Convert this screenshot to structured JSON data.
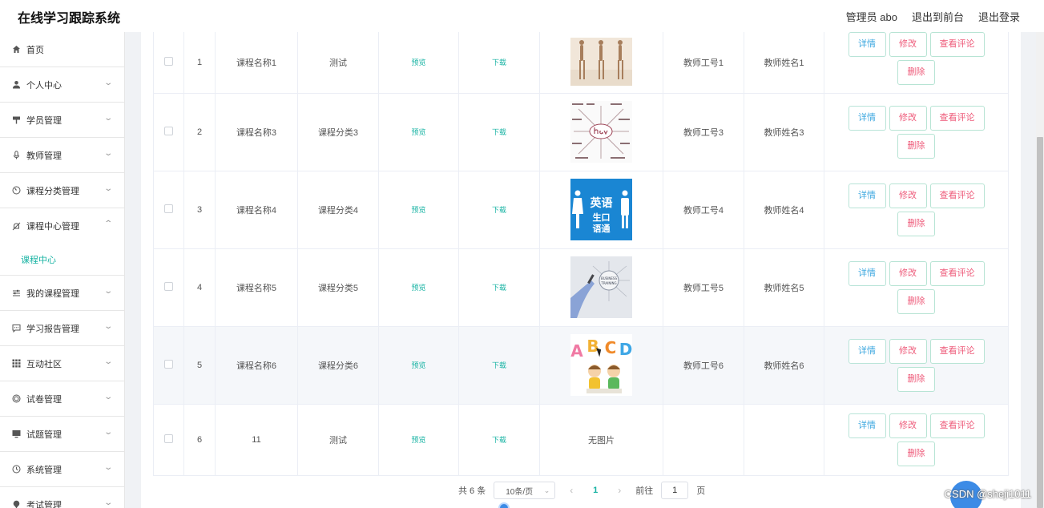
{
  "app": {
    "title": "在线学习跟踪系统",
    "user_label": "管理员 abo",
    "frontend_link": "退出到前台",
    "logout_link": "退出登录"
  },
  "sidebar": {
    "items": [
      {
        "label": "首页",
        "icon": "home-icon",
        "expandable": false
      },
      {
        "label": "个人中心",
        "icon": "user-icon",
        "expandable": true
      },
      {
        "label": "学员管理",
        "icon": "flag-icon",
        "expandable": true
      },
      {
        "label": "教师管理",
        "icon": "mic-icon",
        "expandable": true
      },
      {
        "label": "课程分类管理",
        "icon": "gauge-icon",
        "expandable": true
      },
      {
        "label": "课程中心管理",
        "icon": "bell-off-icon",
        "expandable": true,
        "expanded": true
      }
    ],
    "submenu_active": "课程中心",
    "items_after": [
      {
        "label": "我的课程管理",
        "icon": "sliders-icon",
        "expandable": true
      },
      {
        "label": "学习报告管理",
        "icon": "chat-icon",
        "expandable": true
      },
      {
        "label": "互动社区",
        "icon": "grid-icon",
        "expandable": true
      },
      {
        "label": "试卷管理",
        "icon": "target-icon",
        "expandable": true
      },
      {
        "label": "试题管理",
        "icon": "monitor-icon",
        "expandable": true
      },
      {
        "label": "系统管理",
        "icon": "clock-icon",
        "expandable": true
      },
      {
        "label": "考试管理",
        "icon": "pin-icon",
        "expandable": true
      }
    ],
    "accent_color": "#17b3a3"
  },
  "table": {
    "preview_label": "预览",
    "download_label": "下载",
    "no_image_label": "无图片",
    "buttons": {
      "detail": "详情",
      "edit": "修改",
      "review": "查看评论",
      "delete": "删除"
    },
    "rows": [
      {
        "index": "1",
        "name": "课程名称1",
        "category": "测试",
        "image": "runners-photo",
        "teacher_id": "教师工号1",
        "teacher_name": "教师姓名1"
      },
      {
        "index": "2",
        "name": "课程名称3",
        "category": "课程分类3",
        "image": "word-cloud-have",
        "teacher_id": "教师工号3",
        "teacher_name": "教师姓名3"
      },
      {
        "index": "3",
        "name": "课程名称4",
        "category": "课程分类4",
        "image": "english-sign",
        "image_text_1": "英语",
        "image_text_2": "生口",
        "image_text_3": "语通",
        "teacher_id": "教师工号4",
        "teacher_name": "教师姓名4"
      },
      {
        "index": "4",
        "name": "课程名称5",
        "category": "课程分类5",
        "image": "business-training",
        "image_text_1": "BUSINESS",
        "image_text_2": "TRAINING",
        "teacher_id": "教师工号5",
        "teacher_name": "教师姓名5"
      },
      {
        "index": "5",
        "name": "课程名称6",
        "category": "课程分类6",
        "image": "abcd-kids",
        "image_text_1": "A",
        "image_text_2": "B",
        "image_text_3": "C",
        "image_text_4": "D",
        "teacher_id": "教师工号6",
        "teacher_name": "教师姓名6"
      },
      {
        "index": "6",
        "name": "11",
        "category": "测试",
        "image": "none",
        "teacher_id": "",
        "teacher_name": ""
      }
    ]
  },
  "pagination": {
    "total": "共 6 条",
    "page_size": "10条/页",
    "current_page": "1",
    "goto_label": "前往",
    "goto_value": "1",
    "page_unit": "页"
  },
  "watermark": "CSDN @sheji1011"
}
